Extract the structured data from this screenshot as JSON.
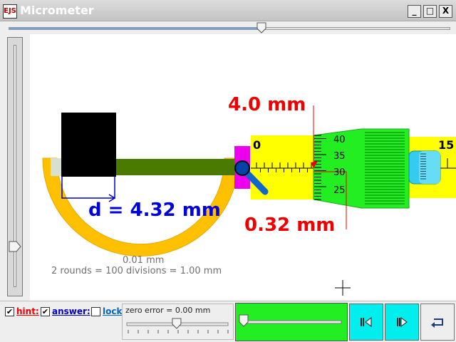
{
  "window": {
    "app_icon": "EJS",
    "title": "Micrometer",
    "minimize": "_",
    "maximize": "□",
    "close": "X"
  },
  "sliders": {
    "top_position_percent": 58,
    "left_position_percent": 20,
    "zero_error_position_percent": 47,
    "speed_position_percent": 0
  },
  "micrometer": {
    "main_scale_reading": "4.0 mm",
    "thimble_reading": "0.32 mm",
    "measurement": "d = 4.32 mm",
    "least_count": "0.01 mm",
    "scale_rule": "2 rounds = 100 divisions = 1.00 mm",
    "sleeve_start": "0",
    "sleeve_end": "15",
    "thimble_ticks": [
      "40",
      "35",
      "30",
      "25"
    ]
  },
  "controls": {
    "hint": {
      "checked": true,
      "label": "hint:"
    },
    "answer": {
      "checked": true,
      "label": "answer:"
    },
    "lock": {
      "checked": false,
      "label": "lock"
    },
    "zero_error_label": "zero error = 0.00 mm"
  },
  "icons": {
    "step_back": "step-back-icon",
    "step_forward": "step-forward-icon",
    "reset": "reset-icon"
  },
  "colors": {
    "frame": "#ffc000",
    "spindle": "#4a7a00",
    "sleeve": "#ffff00",
    "thimble": "#22ee22",
    "anvil_pad": "#ee00ee",
    "reading_red": "#ee0000",
    "measurement_blue": "#0000dd",
    "ratchet": "#33ccee"
  }
}
